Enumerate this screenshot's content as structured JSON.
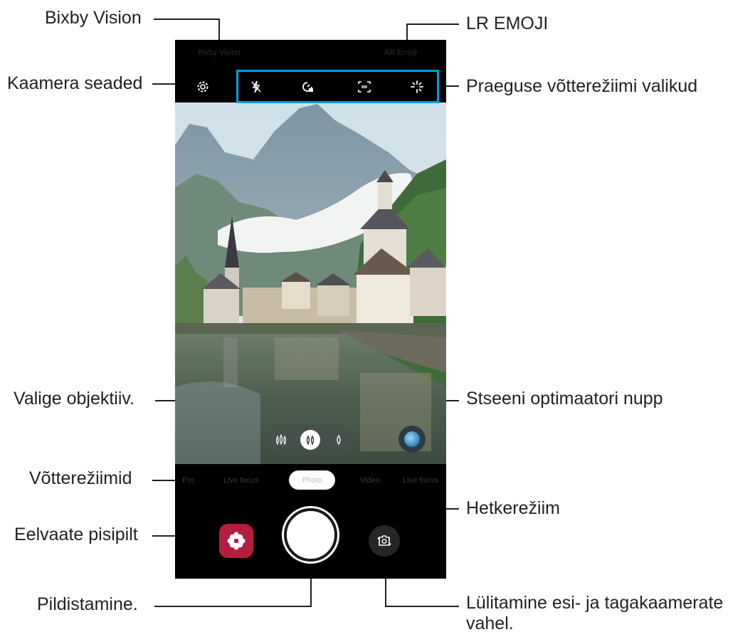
{
  "callouts": {
    "bixby_vision": "Bixby Vision",
    "lr_emoji": "LR EMOJI",
    "camera_settings": "Kaamera seaded",
    "mode_options": "Praeguse võtterežiimi valikud",
    "choose_lens": "Valige objektiiv.",
    "scene_optimizer": "Stseeni optimaatori nupp",
    "shooting_modes": "Võtterežiimid",
    "current_mode": "Hetkerežiim",
    "preview_thumbnail": "Eelvaate pisipilt",
    "take_picture": "Pildistamine.",
    "switch_cameras_line1": "Lülitamine esi- ja tagakaamerate",
    "switch_cameras_line2": "vahel."
  },
  "screen": {
    "top_left": "Bixby Vision",
    "top_right": "AR Emoji",
    "modes": [
      "Pro",
      "Live focus",
      "Photo",
      "Video",
      "Live focus"
    ],
    "selected_mode": "Photo"
  },
  "icons": {
    "settings": "gear-icon",
    "flash": "flash-off-icon",
    "timer": "timer-icon",
    "ratio": "aspect-ratio-icon",
    "filter": "sparkle-filter-icon",
    "lens_wide": "ultra-wide-lens-icon",
    "lens_normal": "wide-lens-icon",
    "lens_tele": "telephoto-lens-icon",
    "scene": "scene-optimizer-icon",
    "gallery": "gallery-flower-icon",
    "switch": "switch-camera-icon"
  },
  "colors": {
    "accent_frame": "#009ee3",
    "thumbnail": "#b51d3f",
    "text": "#231f20"
  }
}
